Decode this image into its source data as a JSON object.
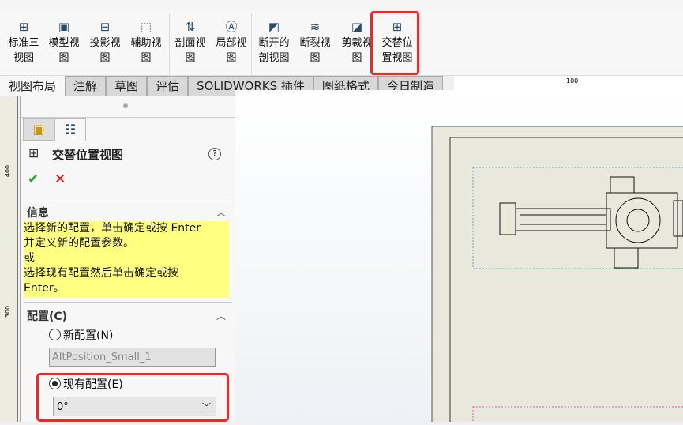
{
  "ribbon": {
    "buttons": [
      {
        "l1": "标准三",
        "l2": "视图",
        "icon": "standard-3-view-icon"
      },
      {
        "l1": "模型视",
        "l2": "图",
        "icon": "model-view-icon"
      },
      {
        "l1": "投影视",
        "l2": "图",
        "icon": "projected-view-icon"
      },
      {
        "l1": "辅助视",
        "l2": "图",
        "icon": "auxiliary-view-icon"
      },
      {
        "l1": "剖面视",
        "l2": "图",
        "icon": "section-view-icon"
      },
      {
        "l1": "局部视",
        "l2": "图",
        "icon": "detail-view-icon"
      },
      {
        "l1": "断开的",
        "l2": "剖视图",
        "icon": "broken-out-section-icon"
      },
      {
        "l1": "断裂视",
        "l2": "图",
        "icon": "break-view-icon"
      },
      {
        "l1": "剪裁视",
        "l2": "图",
        "icon": "crop-view-icon"
      },
      {
        "l1": "交替位",
        "l2": "置视图",
        "icon": "alternate-position-view-icon"
      }
    ]
  },
  "tabs": [
    "视图布局",
    "注解",
    "草图",
    "评估",
    "SOLIDWORKS 插件",
    "图纸格式",
    "今日制造"
  ],
  "rulers": {
    "top": "100",
    "left": [
      "400",
      "300"
    ]
  },
  "panel": {
    "title": "交替位置视图",
    "info_header": "信息",
    "info_lines": [
      "选择新的配置，单击确定或按 Enter",
      "并定义新的配置参数。",
      "或",
      "选择现有配置然后单击确定或按",
      "Enter。"
    ],
    "config_header": "配置(C)",
    "new_config_label": "新配置(N)",
    "new_config_value": "AltPosition_Small_1",
    "existing_config_label": "现有配置(E)",
    "existing_config_value": "0°",
    "selected": "existing"
  },
  "colors": {
    "highlight": "#ff2222",
    "info_bg": "#ffff80"
  }
}
